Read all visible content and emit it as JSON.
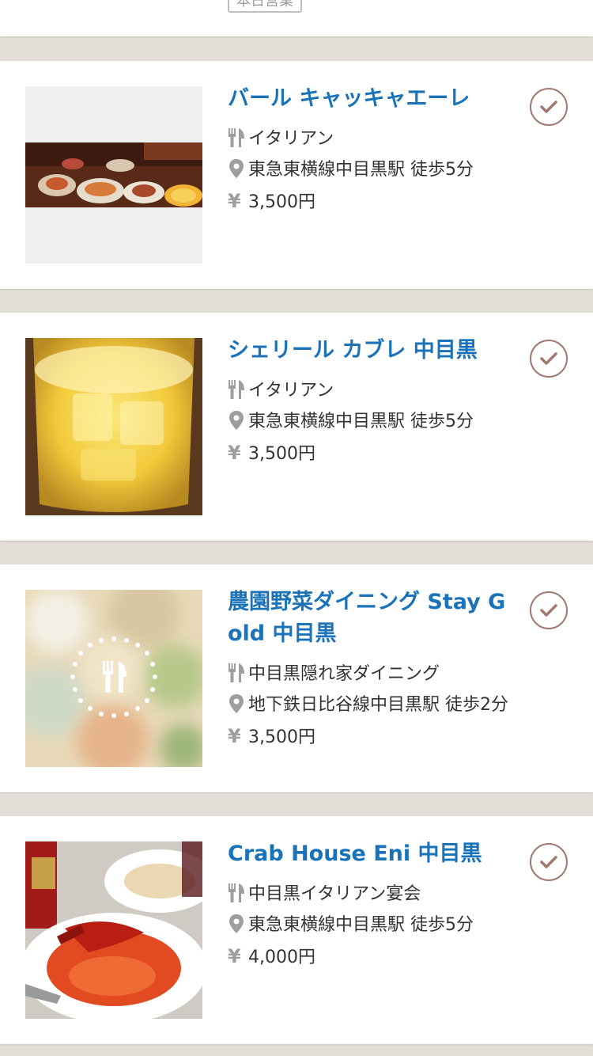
{
  "top_card": {
    "badge": "本日営業"
  },
  "restaurants": [
    {
      "name": "バール キャッキャエーレ",
      "genre": "イタリアン",
      "access": "東急東横線中目黒駅 徒歩5分",
      "price": "3,500円",
      "image": "food-photo-platter"
    },
    {
      "name": "シェリール カブレ 中目黒",
      "genre": "イタリアン",
      "access": "東急東横線中目黒駅 徒歩5分",
      "price": "3,500円",
      "image": "drink-photo-juice"
    },
    {
      "name": "農園野菜ダイニング Stay Gold 中目黒",
      "genre": "中目黒隠れ家ダイニング",
      "access": "地下鉄日比谷線中目黒駅 徒歩2分",
      "price": "3,500円",
      "image": "no-image-placeholder"
    },
    {
      "name": "Crab House Eni 中目黒",
      "genre": "中目黒イタリアン宴会",
      "access": "東急東横線中目黒駅 徒歩5分",
      "price": "4,000円",
      "image": "food-photo-lobster-pasta"
    }
  ],
  "colors": {
    "title": "#1a73b8",
    "check": "#a07a70",
    "background": "#e3ddd7"
  },
  "icons": {
    "genre": "fork-knife-icon",
    "access": "location-pin-icon",
    "price": "yen-icon",
    "action": "check-circle-icon"
  }
}
